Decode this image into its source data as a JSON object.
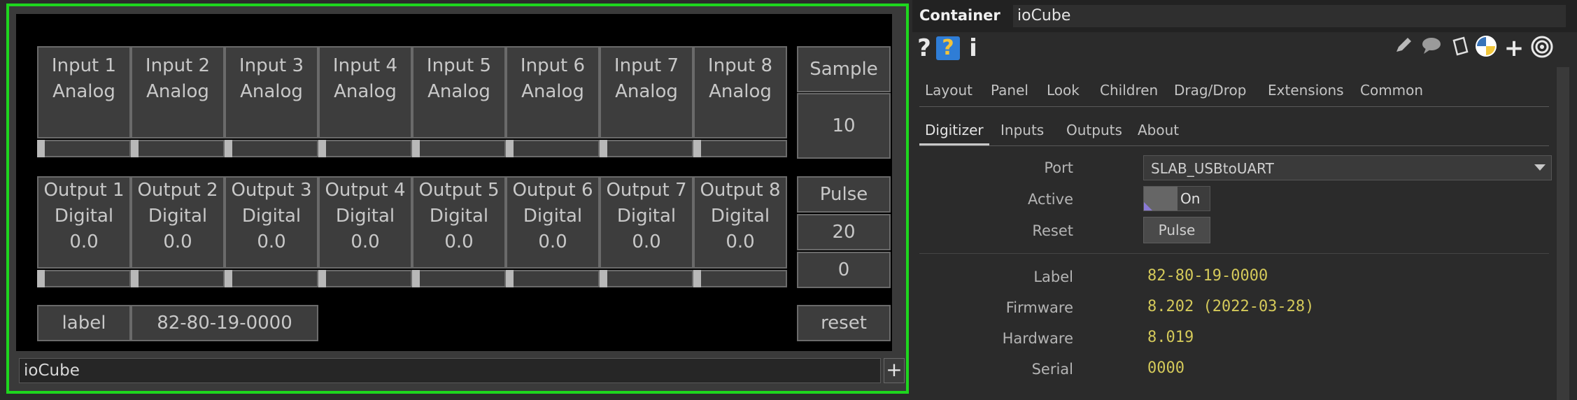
{
  "viewer": {
    "inputs": [
      {
        "title": "Input 1",
        "type": "Analog"
      },
      {
        "title": "Input 2",
        "type": "Analog"
      },
      {
        "title": "Input 3",
        "type": "Analog"
      },
      {
        "title": "Input 4",
        "type": "Analog"
      },
      {
        "title": "Input 5",
        "type": "Analog"
      },
      {
        "title": "Input 6",
        "type": "Analog"
      },
      {
        "title": "Input 7",
        "type": "Analog"
      },
      {
        "title": "Input 8",
        "type": "Analog"
      }
    ],
    "outputs": [
      {
        "title": "Output 1",
        "type": "Digital",
        "value": "0.0"
      },
      {
        "title": "Output 2",
        "type": "Digital",
        "value": "0.0"
      },
      {
        "title": "Output 3",
        "type": "Digital",
        "value": "0.0"
      },
      {
        "title": "Output 4",
        "type": "Digital",
        "value": "0.0"
      },
      {
        "title": "Output 5",
        "type": "Digital",
        "value": "0.0"
      },
      {
        "title": "Output 6",
        "type": "Digital",
        "value": "0.0"
      },
      {
        "title": "Output 7",
        "type": "Digital",
        "value": "0.0"
      },
      {
        "title": "Output 8",
        "type": "Digital",
        "value": "0.0"
      }
    ],
    "sample": {
      "label": "Sample",
      "value": "10"
    },
    "pulse": {
      "label": "Pulse",
      "value": "20",
      "value2": "0"
    },
    "label_key": "label",
    "label_value": "82-80-19-0000",
    "reset": "reset",
    "footer_name": "ioCube",
    "footer_add_icon": "+",
    "accent_color": "#1ed61e"
  },
  "panel": {
    "type_label": "Container",
    "node_name": "ioCube",
    "toolbar": {
      "help": "?",
      "python_help": "?",
      "info": "i",
      "plus": "+"
    },
    "page_tabs": [
      "Layout",
      "Panel",
      "Look",
      "Children",
      "Drag/Drop",
      "Extensions",
      "Common"
    ],
    "custom_tabs": [
      "Digitizer",
      "Inputs",
      "Outputs",
      "About"
    ],
    "params": {
      "port": {
        "label": "Port",
        "value": "SLAB_USBtoUART"
      },
      "active": {
        "label": "Active",
        "value": "On"
      },
      "reset": {
        "label": "Reset",
        "value": "Pulse"
      }
    },
    "info": [
      {
        "label": "Label",
        "value": "82-80-19-0000"
      },
      {
        "label": "Firmware",
        "value": "8.202 (2022-03-28)"
      },
      {
        "label": "Hardware",
        "value": "8.019"
      },
      {
        "label": "Serial",
        "value": "0000"
      }
    ],
    "value_color": "#d4c95a"
  }
}
